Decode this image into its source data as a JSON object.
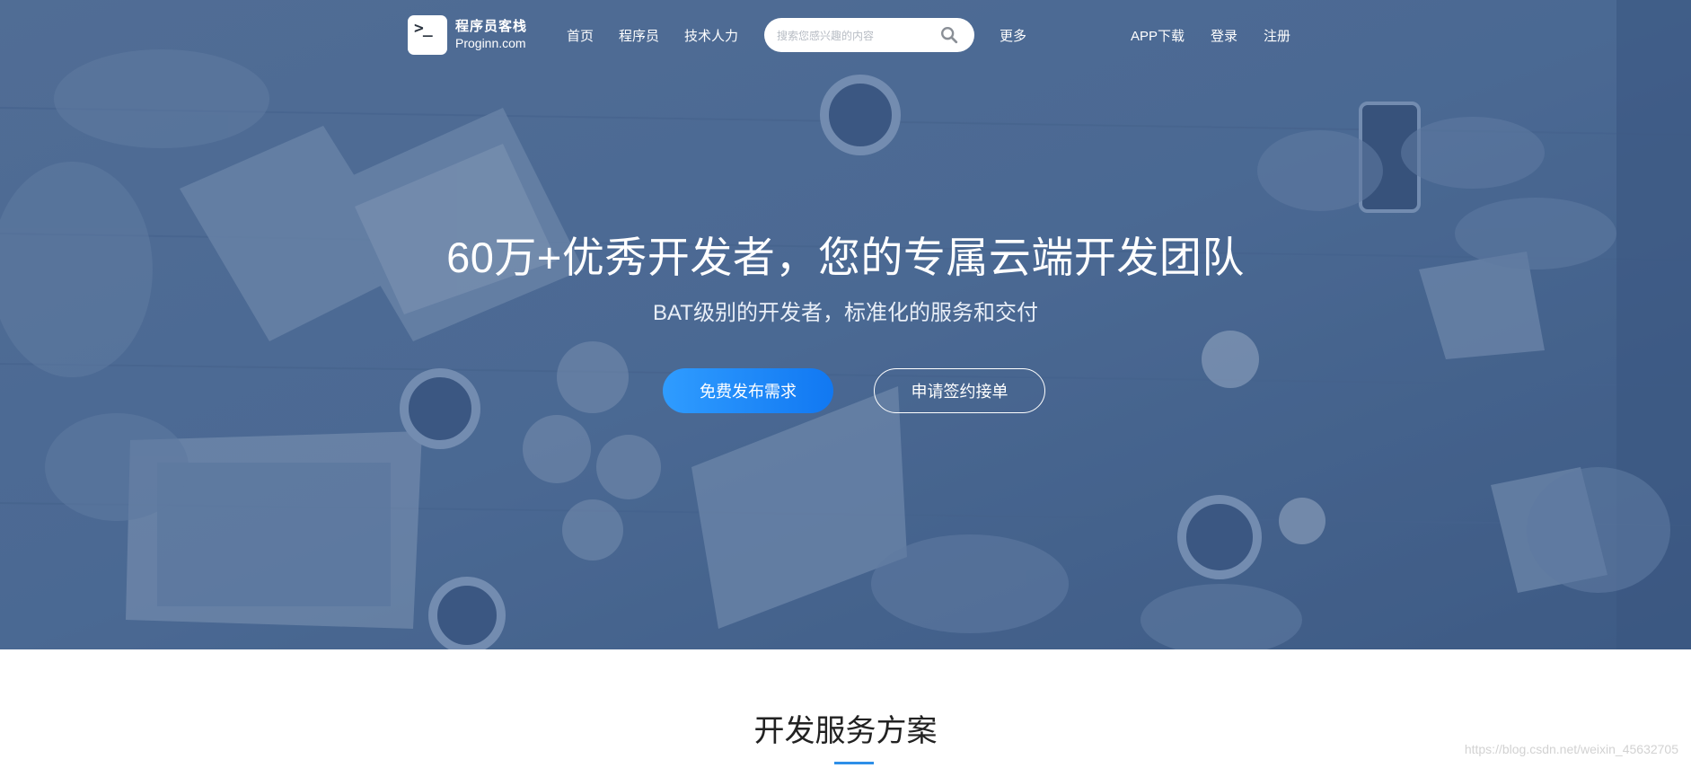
{
  "header": {
    "logo": {
      "icon": "terminal-prompt-icon",
      "glyph": ">_",
      "name": "程序员客栈",
      "domain": "Proginn.com"
    },
    "nav": [
      {
        "label": "首页"
      },
      {
        "label": "程序员"
      },
      {
        "label": "技术人力"
      }
    ],
    "search": {
      "value": "",
      "placeholder": "搜索您感兴趣的内容",
      "icon": "search-icon"
    },
    "more_label": "更多",
    "right_links": [
      {
        "label": "APP下载"
      },
      {
        "label": "登录"
      },
      {
        "label": "注册"
      }
    ]
  },
  "hero": {
    "title": "60万+优秀开发者，您的专属云端开发团队",
    "subtitle": "BAT级别的开发者，标准化的服务和交付",
    "primary_button": "免费发布需求",
    "secondary_button": "申请签约接单",
    "overlay_color": "#4f6b93"
  },
  "section": {
    "title": "开发服务方案",
    "accent_color": "#2e8fe8"
  },
  "watermark": "https://blog.csdn.net/weixin_45632705",
  "colors": {
    "primary_button": "#1a86f5",
    "hero_bg": "#4f6b93"
  }
}
